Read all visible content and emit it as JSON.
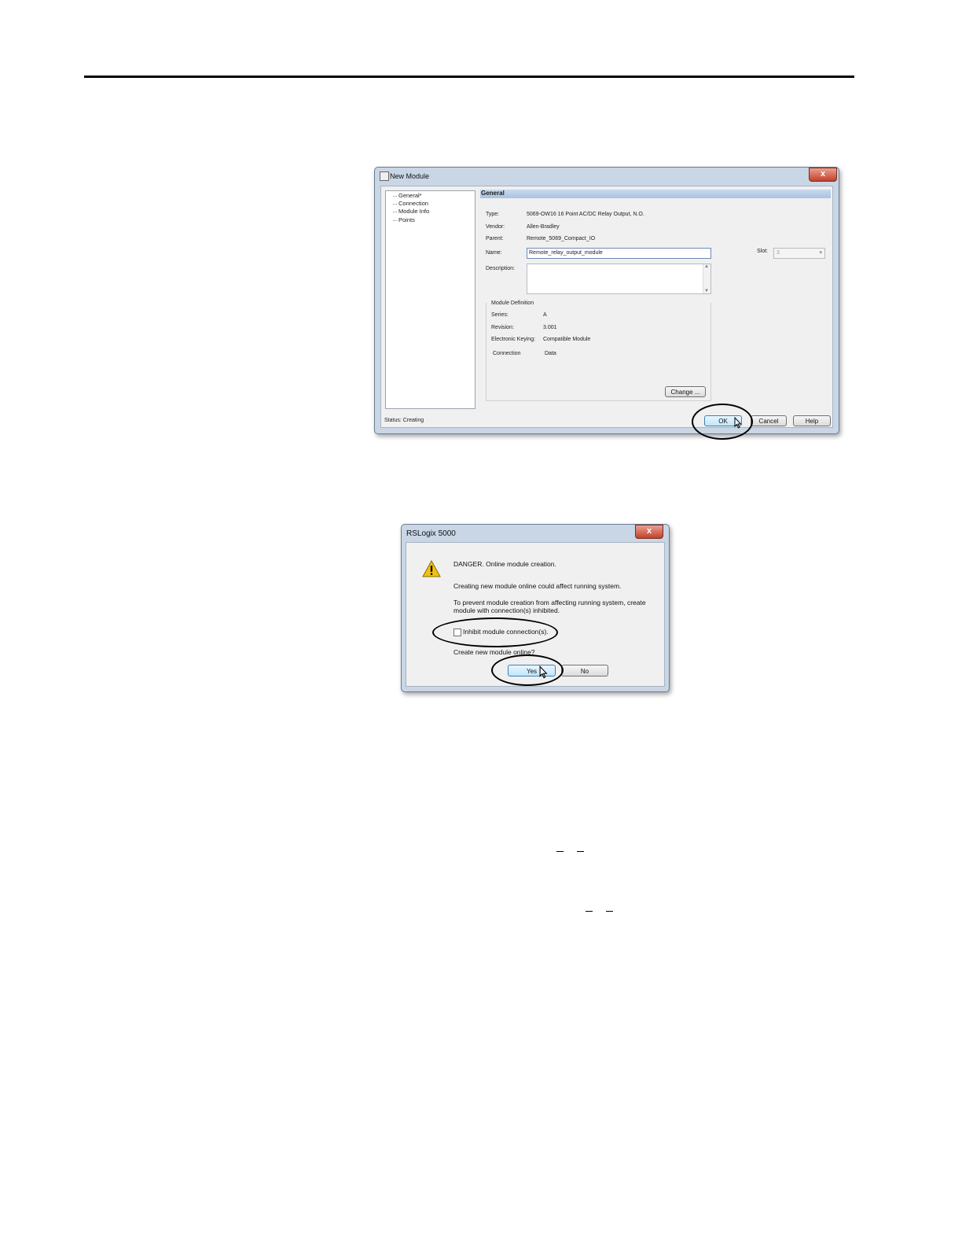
{
  "new_module": {
    "title": "New Module",
    "close_glyph": "x",
    "tree": [
      "General*",
      "Connection",
      "Module Info",
      "Points"
    ],
    "section_title": "General",
    "type_label": "Type:",
    "type_value": "5069-OW16 16 Point AC/DC Relay Output, N.O.",
    "vendor_label": "Vendor:",
    "vendor_value": "Allen-Bradley",
    "parent_label": "Parent:",
    "parent_value": "Remote_5069_Compact_IO",
    "name_label": "Name:",
    "name_value": "Remote_relay_output_module",
    "description_label": "Description:",
    "slot_label": "Slot:",
    "slot_value": "3",
    "module_definition": {
      "title": "Module Definition",
      "series_label": "Series:",
      "series_value": "A",
      "revision_label": "Revision:",
      "revision_value": "3.001",
      "keying_label": "Electronic Keying:",
      "keying_value": "Compatible Module",
      "connection_label": "Connection",
      "connection_value": "Data",
      "change_button": "Change ..."
    },
    "status_text": "Status:  Creating",
    "ok_button": "OK",
    "cancel_button": "Cancel",
    "help_button": "Help"
  },
  "rslogix_dialog": {
    "title": "RSLogix 5000",
    "close_glyph": "x",
    "icon": "warning-icon",
    "line1": "DANGER. Online module creation.",
    "line2": "Creating new module online could affect running system.",
    "line3a": "To prevent module creation from affecting running system, create",
    "line3b": "module with connection(s) inhibited.",
    "inhibit_label": "Inhibit module connection(s).",
    "inhibit_checked": false,
    "question": "Create new module online?",
    "yes_button": "Yes",
    "no_button": "No"
  }
}
